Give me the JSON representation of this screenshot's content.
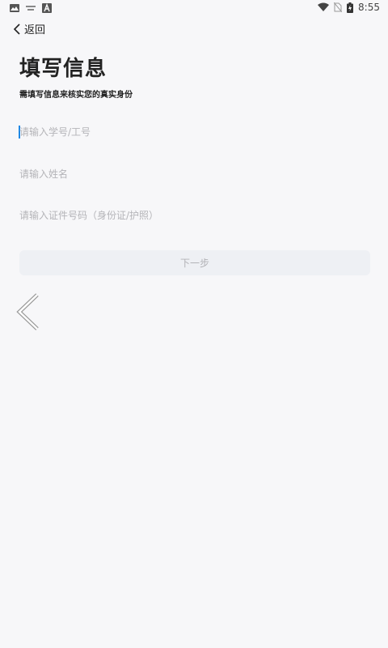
{
  "status_bar": {
    "time": "8:55",
    "left_icons": [
      "image-icon",
      "keyboard-icon",
      "a-icon"
    ],
    "right_icons": [
      "wifi-icon",
      "no-sim-icon",
      "battery-icon"
    ]
  },
  "nav": {
    "back_label": "返回"
  },
  "form": {
    "title": "填写信息",
    "subtitle": "需填写信息来核实您的真实身份",
    "id_placeholder": "请输入学号/工号",
    "name_placeholder": "请输入姓名",
    "cert_placeholder": "请输入证件号码（身份证/护照）",
    "next_label": "下一步"
  },
  "colors": {
    "background": "#f7f7f9",
    "button_bg": "#eef0f4",
    "placeholder": "#b4b4b8",
    "caret": "#1e88e5"
  }
}
